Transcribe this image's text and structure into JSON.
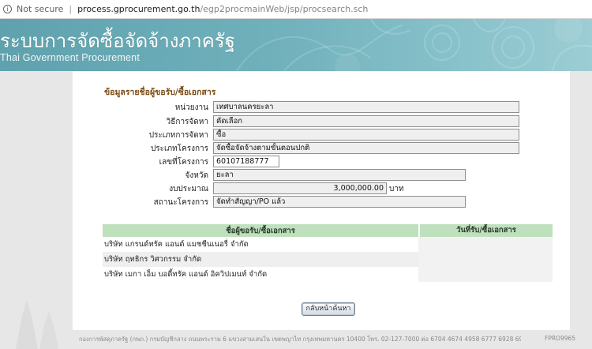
{
  "browser": {
    "security_label": "Not secure",
    "url_host": "process.gprocurement.go.th",
    "url_path": "/egp2procmainWeb/jsp/procsearch.sch"
  },
  "banner": {
    "title": "ระบบการจัดซื้อจัดจ้างภาครัฐ",
    "subtitle": "Thai Government Procurement"
  },
  "form": {
    "section_title": "ข้อมูลรายชื่อผู้ขอรับ/ซื้อเอกสาร",
    "fields": [
      {
        "label": "หน่วยงาน",
        "value": "เทศบาลนครยะลา"
      },
      {
        "label": "วิธีการจัดหา",
        "value": "คัดเลือก"
      },
      {
        "label": "ประเภทการจัดหา",
        "value": "ซื้อ"
      },
      {
        "label": "ประเภทโครงการ",
        "value": "จัดซื้อจัดจ้างตามขั้นตอนปกติ"
      },
      {
        "label": "เลขที่โครงการ",
        "value": "60107188777"
      },
      {
        "label": "จังหวัด",
        "value": "ยะลา"
      },
      {
        "label": "งบประมาณ",
        "value": "3,000,000.00",
        "unit": "บาท"
      },
      {
        "label": "สถานะโครงการ",
        "value": "จัดทำสัญญา/PO แล้ว"
      }
    ]
  },
  "table": {
    "headers": [
      "ชื่อผู้ขอรับ/ซื้อเอกสาร",
      "วันที่รับ/ซื้อเอกสาร"
    ],
    "rows": [
      {
        "name": "บริษัท แกรนด์ทรัค แอนด์ แมชชีนเนอรี่ จำกัด",
        "date": ""
      },
      {
        "name": "บริษัท ฤทธิกร วิศวกรรม จำกัด",
        "date": ""
      },
      {
        "name": "บริษัท เมกา เอ็ม บอดี้ทรัค แอนด์ อิควิปเมนท์ จำกัด",
        "date": ""
      }
    ]
  },
  "back_button_label": "กลับหน้าค้นหา",
  "footer": {
    "text": "กองการพัสดุภาครัฐ (กพภ.) กรมบัญชีกลาง ถนนพระราม 6 แขวงสามเสนใน เขตพญาไท กรุงเทพมหานคร 10400 โทร. 02-127-7000 ต่อ 6704 4674 4958 6777 6928 6934",
    "code": "FPRO9965"
  },
  "colors": {
    "banner": "#6fb0bb",
    "section_title": "#7a4a12",
    "table_header": "#bfe0bd"
  }
}
